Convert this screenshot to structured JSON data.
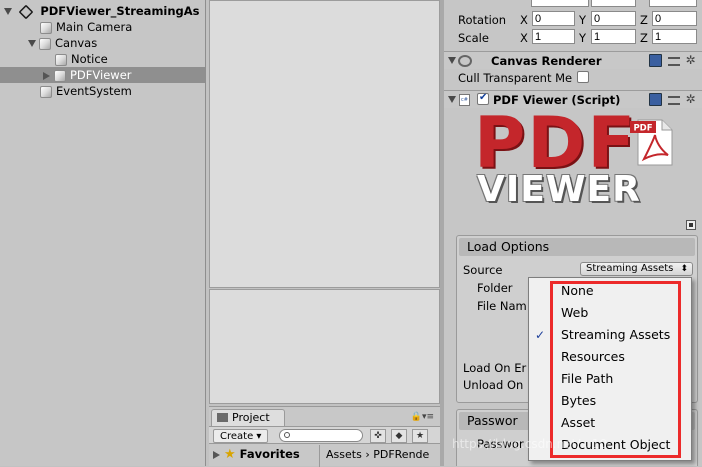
{
  "hierarchy": {
    "items": [
      {
        "label": "PDFViewer_StreamingAs",
        "kind": "scene",
        "expanded": true
      },
      {
        "label": "Main Camera",
        "kind": "gameobject"
      },
      {
        "label": "Canvas",
        "kind": "gameobject",
        "expanded": true
      },
      {
        "label": "Notice",
        "kind": "gameobject"
      },
      {
        "label": "PDFViewer",
        "kind": "gameobject",
        "selected": true,
        "collapsed": true
      },
      {
        "label": "EventSystem",
        "kind": "gameobject"
      }
    ]
  },
  "inspector": {
    "transform": {
      "rotation": {
        "label": "Rotation",
        "x": "0",
        "y": "0",
        "z": "0"
      },
      "scale": {
        "label": "Scale",
        "x": "1",
        "y": "1",
        "z": "1"
      },
      "axis_x": "X",
      "axis_y": "Y",
      "axis_z": "Z"
    },
    "canvas_renderer": {
      "title": "Canvas Renderer",
      "cull_label": "Cull Transparent Me"
    },
    "pdf_viewer_script": {
      "title": "PDF Viewer (Script)",
      "logo_top": "PDF",
      "logo_bottom": "VIEWER",
      "file_icon_text": "PDF",
      "load_options": {
        "title": "Load Options",
        "source_label": "Source",
        "source_value": "Streaming Assets",
        "folder_label": "Folder",
        "file_name_label": "File Nam",
        "load_on_label": "Load On Er",
        "unload_on_label": "Unload On"
      },
      "password": {
        "title": "Passwor",
        "field_label": "Passwor"
      }
    }
  },
  "source_menu": {
    "items": [
      "None",
      "Web",
      "Streaming Assets",
      "Resources",
      "File Path",
      "Bytes",
      "Asset",
      "Document Object"
    ],
    "selected": "Streaming Assets",
    "check_glyph": "✓",
    "highlight_color": "#ec2a2a"
  },
  "project": {
    "tab_label": "Project",
    "create_label": "Create",
    "favorites_label": "Favorites",
    "breadcrumb_root": "Assets",
    "breadcrumb_sep": "›",
    "breadcrumb_current": "PDFRende"
  },
  "watermark": "https://blog.csdn.net/...10"
}
